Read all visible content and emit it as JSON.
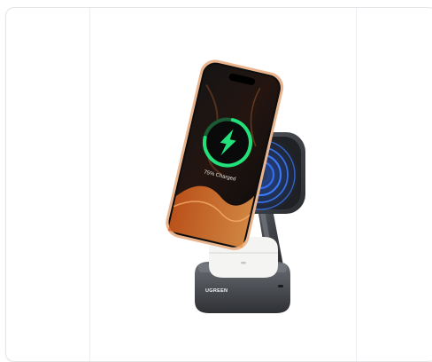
{
  "product": {
    "phone_status": "75% Charged",
    "brand": "UGREEN",
    "colors": {
      "charge_ring": "#22e07a",
      "wave_ring": "#2f6ff0",
      "phone_frame": "#e9b58f",
      "stand": "#3c3f45"
    }
  }
}
